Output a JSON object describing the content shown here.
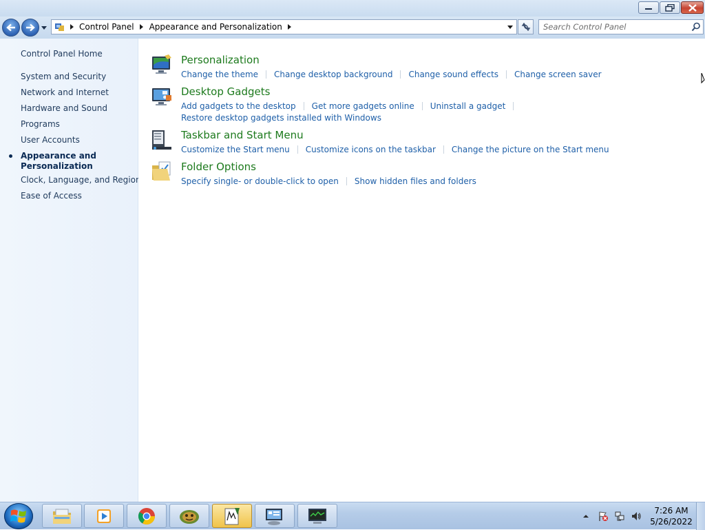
{
  "window": {
    "controls": {
      "minimize": "minimize",
      "maximize": "restore",
      "close": "close"
    }
  },
  "address": {
    "breadcrumb": [
      "Control Panel",
      "Appearance and Personalization"
    ],
    "search_placeholder": "Search Control Panel"
  },
  "sidebar": {
    "items": [
      {
        "label": "Control Panel Home"
      },
      {
        "label": "System and Security"
      },
      {
        "label": "Network and Internet"
      },
      {
        "label": "Hardware and Sound"
      },
      {
        "label": "Programs"
      },
      {
        "label": "User Accounts"
      },
      {
        "label_line1": "Appearance and",
        "label_line2": "Personalization",
        "current": true
      },
      {
        "label": "Clock, Language, and Region"
      },
      {
        "label": "Ease of Access"
      }
    ]
  },
  "categories": [
    {
      "title": "Personalization",
      "icon": "personalization-icon",
      "tasks": [
        "Change the theme",
        "Change desktop background",
        "Change sound effects",
        "Change screen saver"
      ]
    },
    {
      "title": "Desktop Gadgets",
      "icon": "gadgets-icon",
      "tasks": [
        "Add gadgets to the desktop",
        "Get more gadgets online",
        "Uninstall a gadget"
      ],
      "tasks_line2": [
        "Restore desktop gadgets installed with Windows"
      ]
    },
    {
      "title": "Taskbar and Start Menu",
      "icon": "taskbar-icon",
      "tasks": [
        "Customize the Start menu",
        "Customize icons on the taskbar",
        "Change the picture on the Start menu"
      ]
    },
    {
      "title": "Folder Options",
      "icon": "folder-options-icon",
      "tasks": [
        "Specify single- or double-click to open",
        "Show hidden files and folders"
      ]
    }
  ],
  "taskbar": {
    "apps": [
      "windows-explorer-icon",
      "media-player-icon",
      "chrome-icon",
      "app-icon",
      "script-editor-icon",
      "control-panel-icon",
      "system-monitor-icon"
    ],
    "active_app": "script-editor-icon",
    "clock": {
      "time": "7:26 AM",
      "date": "5/26/2022"
    }
  },
  "colors": {
    "category_title": "#1d7a1d",
    "task_link": "#1e5fa8",
    "nav_text": "#1e395b"
  }
}
